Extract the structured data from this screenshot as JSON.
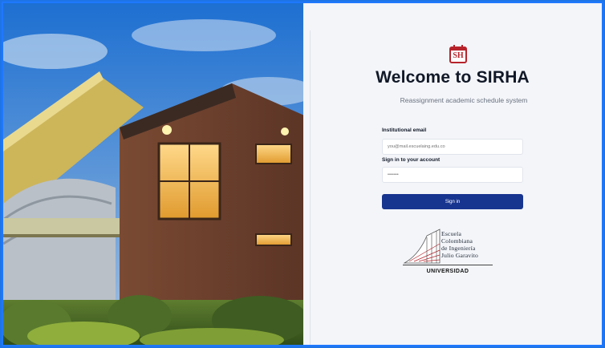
{
  "app": {
    "logo_text": "SH",
    "title": "Welcome to SIRHA",
    "subtitle": "Reassignment academic schedule system"
  },
  "form": {
    "email_label": "Institutional email",
    "email_placeholder": "you@mail.escuelaing.edu.co",
    "password_label": "Sign in to your account",
    "password_placeholder": "•••••••",
    "submit_label": "Sign in"
  },
  "university": {
    "line1": "Escuela",
    "line2": "Colombiana",
    "line3": "de Ingeniería",
    "line4": "Julio Garavito",
    "word": "UNIVERSIDAD"
  },
  "icons": {
    "logo": "calendar-icon",
    "crest": "university-crest-icon"
  },
  "colors": {
    "accent": "#17348f",
    "brand_red": "#b7232b",
    "border": "#1f78ff"
  }
}
